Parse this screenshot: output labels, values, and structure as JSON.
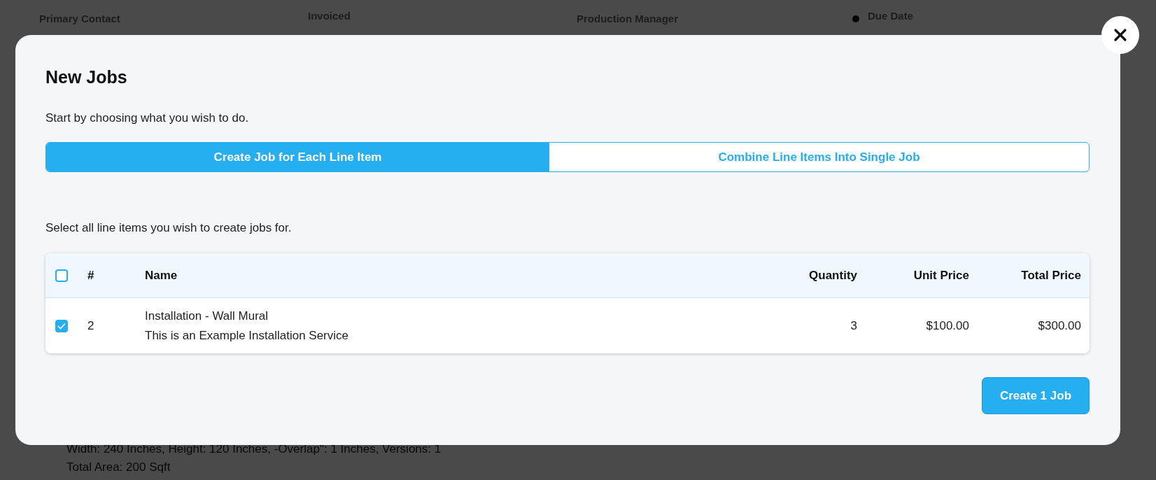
{
  "background": {
    "fields": [
      {
        "label": "Primary Contact"
      },
      {
        "label": "Invoiced"
      },
      {
        "label": "Production Manager"
      },
      {
        "label": "Due Date"
      }
    ],
    "details": [
      "Width: 240 Inches, Height: 120 Inches, -Overlap\": 1 Inches, Versions: 1",
      "Total Area: 200 Sqft"
    ]
  },
  "dialog": {
    "title": "New Jobs",
    "intro": "Start by choosing what you wish to do.",
    "modes": [
      {
        "label": "Create Job for Each Line Item",
        "selected": true
      },
      {
        "label": "Combine Line Items Into Single Job",
        "selected": false
      }
    ],
    "instruction": "Select all line items you wish to create jobs for.",
    "table": {
      "select_all_checked": false,
      "columns": [
        "#",
        "Name",
        "Quantity",
        "Unit Price",
        "Total Price"
      ],
      "rows": [
        {
          "checked": true,
          "number": "2",
          "name": "Installation - Wall Mural",
          "description": "This is an Example Installation Service",
          "quantity": "3",
          "unit_price": "$100.00",
          "total_price": "$300.00"
        }
      ]
    },
    "submit": "Create 1 Job"
  }
}
